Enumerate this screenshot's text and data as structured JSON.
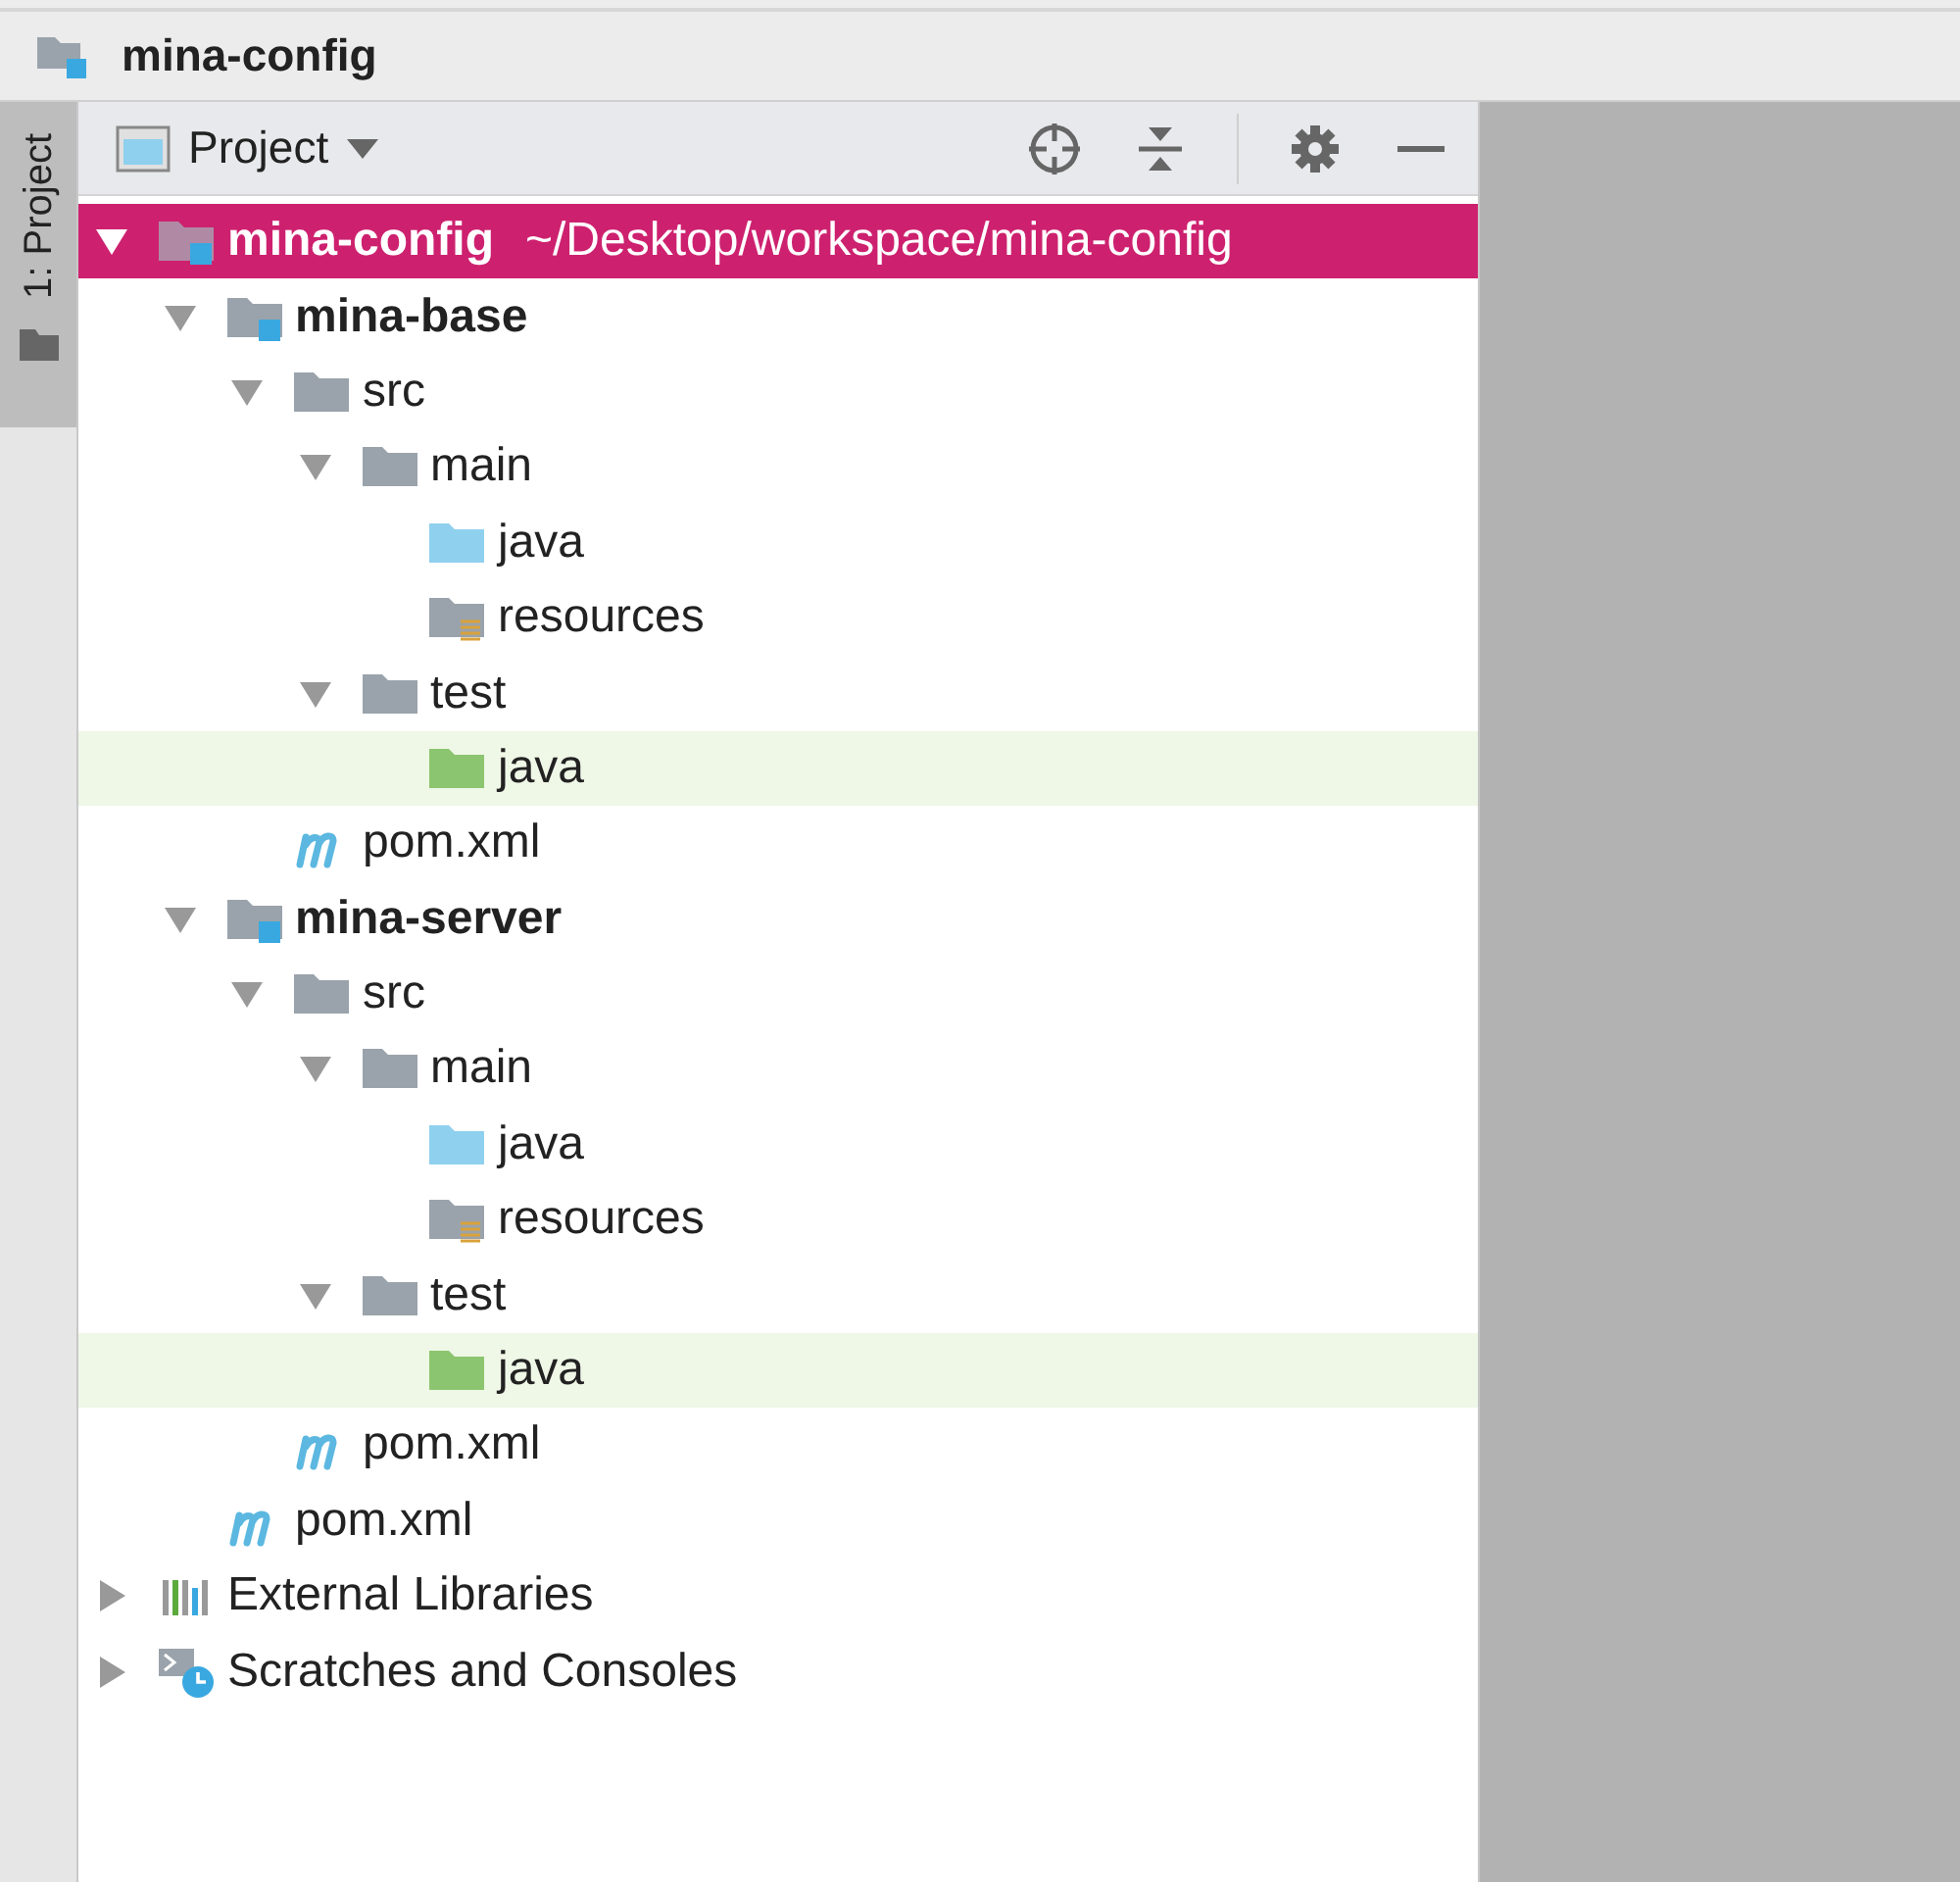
{
  "window": {
    "title": "mina-config"
  },
  "side_tab": {
    "label": "1: Project",
    "selected": true
  },
  "panel": {
    "title": "Project"
  },
  "tree": [
    {
      "label": "mina-config",
      "path": "~/Desktop/workspace/mina-config",
      "kind": "project",
      "expanded": true,
      "selected": true,
      "children": [
        {
          "label": "mina-base",
          "kind": "module",
          "expanded": true,
          "selected": false,
          "children": [
            {
              "label": "src",
              "kind": "folder",
              "expanded": true,
              "selected": false,
              "children": [
                {
                  "label": "main",
                  "kind": "folder",
                  "expanded": true,
                  "selected": false,
                  "children": [
                    {
                      "label": "java",
                      "kind": "source",
                      "selected": false
                    },
                    {
                      "label": "resources",
                      "kind": "resources",
                      "selected": false
                    }
                  ]
                },
                {
                  "label": "test",
                  "kind": "folder",
                  "expanded": true,
                  "selected": false,
                  "children": [
                    {
                      "label": "java",
                      "kind": "test-source",
                      "selected": false
                    }
                  ]
                }
              ]
            },
            {
              "label": "pom.xml",
              "kind": "maven",
              "selected": false
            }
          ]
        },
        {
          "label": "mina-server",
          "kind": "module",
          "expanded": true,
          "selected": false,
          "children": [
            {
              "label": "src",
              "kind": "folder",
              "expanded": true,
              "selected": false,
              "children": [
                {
                  "label": "main",
                  "kind": "folder",
                  "expanded": true,
                  "selected": false,
                  "children": [
                    {
                      "label": "java",
                      "kind": "source",
                      "selected": false
                    },
                    {
                      "label": "resources",
                      "kind": "resources",
                      "selected": false
                    }
                  ]
                },
                {
                  "label": "test",
                  "kind": "folder",
                  "expanded": true,
                  "selected": false,
                  "children": [
                    {
                      "label": "java",
                      "kind": "test-source",
                      "selected": false
                    }
                  ]
                }
              ]
            },
            {
              "label": "pom.xml",
              "kind": "maven",
              "selected": false
            }
          ]
        },
        {
          "label": "pom.xml",
          "kind": "maven",
          "selected": false
        }
      ]
    },
    {
      "label": "External Libraries",
      "kind": "libraries",
      "expanded": false,
      "selected": false
    },
    {
      "label": "Scratches and Consoles",
      "kind": "scratches",
      "expanded": false,
      "selected": false
    }
  ]
}
